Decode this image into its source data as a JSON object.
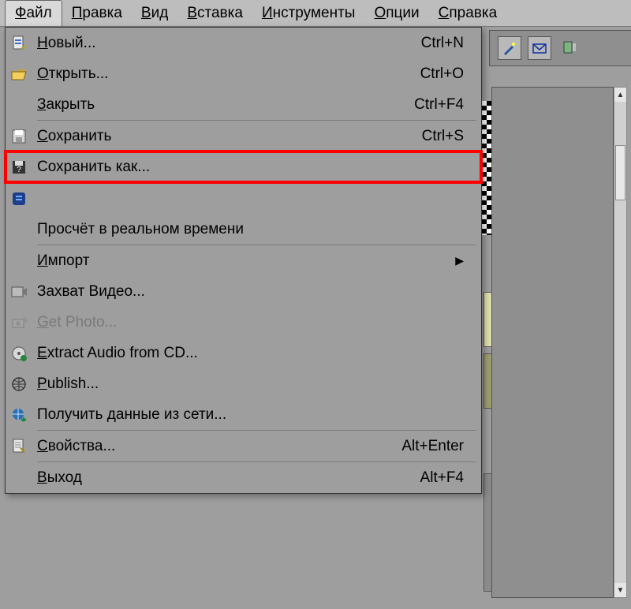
{
  "menubar": {
    "items": [
      {
        "label": "Файл",
        "underlinePrefix": "Ф",
        "rest": "айл",
        "open": true
      },
      {
        "label": "Правка",
        "underlinePrefix": "П",
        "rest": "равка",
        "open": false
      },
      {
        "label": "Вид",
        "underlinePrefix": "В",
        "rest": "ид",
        "open": false
      },
      {
        "label": "Вставка",
        "underlinePrefix": "В",
        "rest": "ставка",
        "open": false
      },
      {
        "label": "Инструменты",
        "underlinePrefix": "И",
        "rest": "нструменты",
        "open": false
      },
      {
        "label": "Опции",
        "underlinePrefix": "О",
        "rest": "пции",
        "open": false
      },
      {
        "label": "Справка",
        "underlinePrefix": "С",
        "rest": "правка",
        "open": false
      }
    ]
  },
  "file_menu": {
    "new": {
      "label": "Новый...",
      "shortcut": "Ctrl+N",
      "underlinePrefix": "Н",
      "rest": "овый..."
    },
    "open": {
      "label": "Открыть...",
      "shortcut": "Ctrl+O",
      "underlinePrefix": "О",
      "rest": "ткрыть..."
    },
    "close": {
      "label": "Закрыть",
      "shortcut": "Ctrl+F4",
      "underlinePrefix": "З",
      "rest": "акрыть"
    },
    "save": {
      "label": "Сохранить",
      "shortcut": "Ctrl+S",
      "underlinePrefix": "С",
      "rest": "охранить"
    },
    "saveas": {
      "label": "Сохранить как...",
      "shortcut": ""
    },
    "render_noicon": {
      "label": ""
    },
    "realtime": {
      "label": "Просчёт в реальном времени",
      "shortcut": ""
    },
    "import": {
      "label": "Импорт",
      "shortcut": "",
      "underlinePrefix": "И",
      "rest": "мпорт",
      "submenu": true
    },
    "capture": {
      "label": "Захват Видео...",
      "shortcut": ""
    },
    "getphoto": {
      "label": "Get Photo...",
      "shortcut": "",
      "underlinePrefix": "G",
      "rest": "et Photo...",
      "disabled": true
    },
    "extract": {
      "label": "Extract Audio from CD...",
      "shortcut": "",
      "underlinePrefix": "E",
      "rest": "xtract Audio from CD..."
    },
    "publish": {
      "label": "Publish...",
      "shortcut": "",
      "underlinePrefix": "P",
      "rest": "ublish..."
    },
    "netdata": {
      "label": "Получить данные из сети...",
      "shortcut": ""
    },
    "props": {
      "label": "Свойства...",
      "shortcut": "Alt+Enter",
      "underlinePrefix": "С",
      "rest": "войства..."
    },
    "exit": {
      "label": "Выход",
      "shortcut": "Alt+F4",
      "underlinePrefix": "В",
      "rest": "ыход"
    }
  },
  "icons": {
    "new": "new-file-icon",
    "open": "folder-open-icon",
    "save": "floppy-icon",
    "saveas": "floppy-question-icon",
    "render": "render-icon",
    "capture": "video-capture-icon",
    "getphoto": "camera-arrow-icon",
    "extract": "cd-audio-icon",
    "publish": "publish-icon",
    "netdata": "globe-download-icon",
    "props": "properties-icon"
  },
  "toolbar_right": {
    "buttons": [
      "wand-icon",
      "envelope-icon",
      "panel-icon"
    ]
  }
}
